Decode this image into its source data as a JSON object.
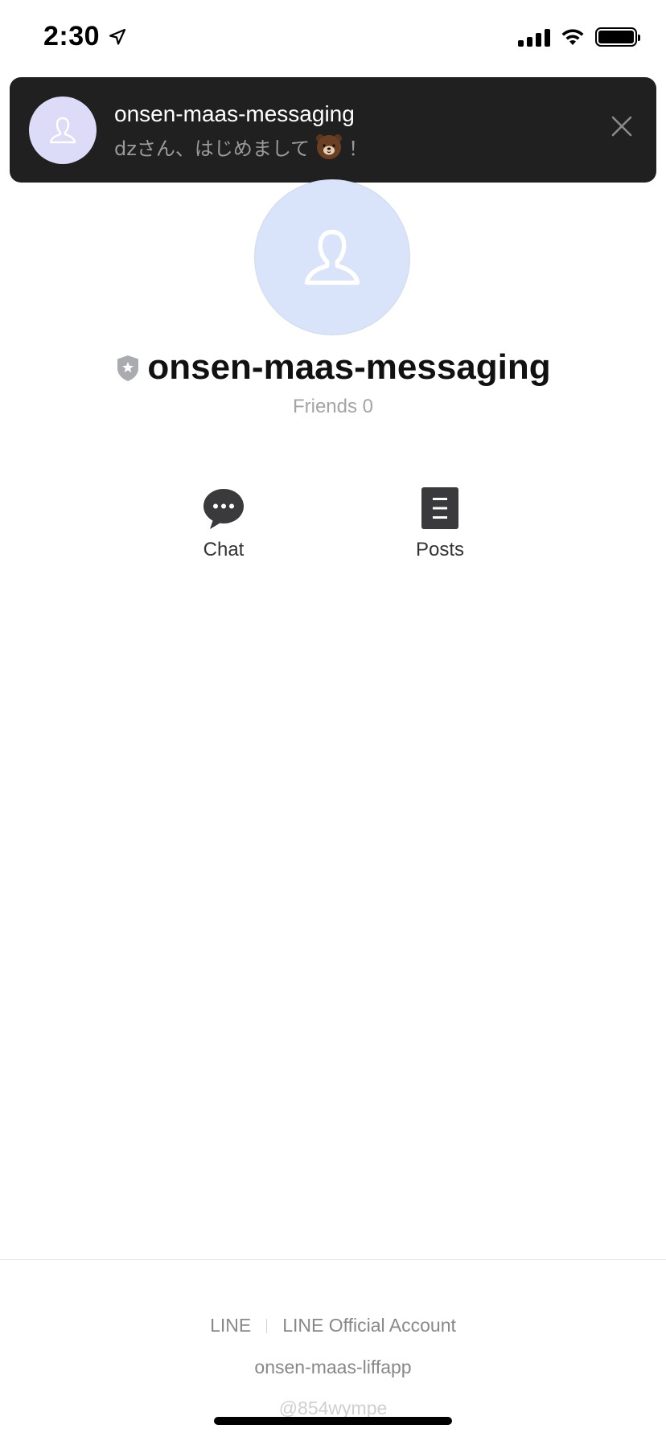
{
  "status_bar": {
    "time": "2:30",
    "location_icon": "location-arrow-icon",
    "signal_icon": "cellular-signal-icon",
    "wifi_icon": "wifi-icon",
    "battery_icon": "battery-icon",
    "battery_level": 1.0
  },
  "notification": {
    "title": "onsen-maas-messaging",
    "message_prefix": "dzさん、はじめまして",
    "message_emoji": "bear-sticker-emoji",
    "message_suffix": "！",
    "close_icon": "close-icon",
    "avatar_icon": "person-icon"
  },
  "profile": {
    "name": "onsen-maas-messaging",
    "badge_icon": "verified-shield-icon",
    "friends": "Friends 0",
    "avatar_icon": "person-icon"
  },
  "actions": [
    {
      "label": "Chat",
      "icon": "chat-bubble-icon"
    },
    {
      "label": "Posts",
      "icon": "posts-icon"
    }
  ],
  "footer": {
    "links": [
      "LINE",
      "LINE Official Account"
    ],
    "app_name": "onsen-maas-liffapp",
    "account_id": "@854wympe"
  },
  "colors": {
    "banner_bg": "#202020",
    "avatar_bg": "#d9e3f9",
    "icon_dark": "#3a3a3c",
    "muted_text": "#a4a4a4"
  }
}
